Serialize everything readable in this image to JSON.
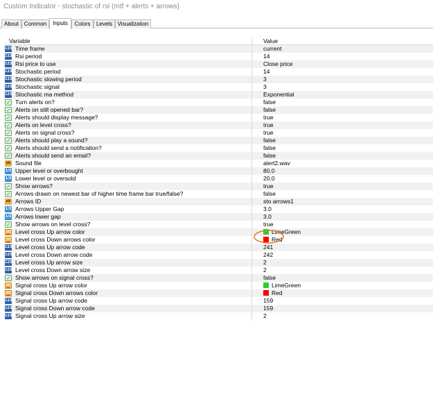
{
  "window_title": "Custom Indicator - stochastic of rsi (mtf + alerts + arrows)",
  "tabs": [
    {
      "label": "About",
      "active": false
    },
    {
      "label": "Common",
      "active": false
    },
    {
      "label": "Inputs",
      "active": true
    },
    {
      "label": "Colors",
      "active": false
    },
    {
      "label": "Levels",
      "active": false
    },
    {
      "label": "Visualization",
      "active": false
    }
  ],
  "columns": {
    "variable": "Variable",
    "value": "Value"
  },
  "icon_labels": {
    "int": "123",
    "double": "1/2",
    "bool": "✓",
    "string": "ab",
    "color": ""
  },
  "rows": [
    {
      "icon": "int",
      "variable": "Time frame",
      "value": "current"
    },
    {
      "icon": "int",
      "variable": "Rsi period",
      "value": "14"
    },
    {
      "icon": "int",
      "variable": "Rsi price to use",
      "value": "Close price"
    },
    {
      "icon": "int",
      "variable": "Stochastic period",
      "value": "14"
    },
    {
      "icon": "int",
      "variable": "Stochastic slowing period",
      "value": "3"
    },
    {
      "icon": "int",
      "variable": "Stochastic signal",
      "value": "3"
    },
    {
      "icon": "int",
      "variable": "Stochastic ma method",
      "value": "Exponential"
    },
    {
      "icon": "bool",
      "variable": "Turn alerts on?",
      "value": "false"
    },
    {
      "icon": "bool",
      "variable": "Alerts on still opened bar?",
      "value": "false"
    },
    {
      "icon": "bool",
      "variable": "Alerts should display message?",
      "value": "true"
    },
    {
      "icon": "bool",
      "variable": "Alerts on level cross?",
      "value": "true"
    },
    {
      "icon": "bool",
      "variable": "Alerts on signal cross?",
      "value": "true"
    },
    {
      "icon": "bool",
      "variable": "Alerts should play a sound?",
      "value": "false"
    },
    {
      "icon": "bool",
      "variable": "Alerts should send a notification?",
      "value": "false"
    },
    {
      "icon": "bool",
      "variable": "Alerts should send an email?",
      "value": "false"
    },
    {
      "icon": "string",
      "variable": "Sound file",
      "value": "alert2.wav"
    },
    {
      "icon": "double",
      "variable": "Upper level or overbought",
      "value": "80.0"
    },
    {
      "icon": "double",
      "variable": "Lower level or oversold",
      "value": "20.0"
    },
    {
      "icon": "bool",
      "variable": "Show arrows?",
      "value": "true"
    },
    {
      "icon": "bool",
      "variable": "Arrows drawn on newest bar of higher time frame bar true/false?",
      "value": "false"
    },
    {
      "icon": "string",
      "variable": "Arrows ID",
      "value": "sto arrows1"
    },
    {
      "icon": "double",
      "variable": "Arrows Upper Gap",
      "value": "3.0"
    },
    {
      "icon": "double",
      "variable": "Arrows lower gap",
      "value": "3.0"
    },
    {
      "icon": "bool",
      "variable": "Show arrows on level cross?",
      "value": "true"
    },
    {
      "icon": "color",
      "variable": "Level cross Up arrow color",
      "value": "LimeGreen",
      "swatch": "#32cd32"
    },
    {
      "icon": "color",
      "variable": "Level cross Down arrows color",
      "value": "Red",
      "swatch": "#ff0000"
    },
    {
      "icon": "int",
      "variable": "Level cross Up arrow code",
      "value": "241"
    },
    {
      "icon": "int",
      "variable": "Level cross Down arrow code",
      "value": "242"
    },
    {
      "icon": "int",
      "variable": "Level cross Up arrow size",
      "value": "2"
    },
    {
      "icon": "int",
      "variable": "Level cross Down arrow size",
      "value": "2"
    },
    {
      "icon": "bool",
      "variable": "Show arrows on signal cross?",
      "value": "false"
    },
    {
      "icon": "color",
      "variable": "Signal cross Up arrow color",
      "value": "LimeGreen",
      "swatch": "#32cd32"
    },
    {
      "icon": "color",
      "variable": "Signal cross Down arrows color",
      "value": "Red",
      "swatch": "#ff0000"
    },
    {
      "icon": "int",
      "variable": "Signal cross Up arrow code",
      "value": "159"
    },
    {
      "icon": "int",
      "variable": "Signal cross Down arrow code",
      "value": "159"
    },
    {
      "icon": "int",
      "variable": "Signal cross Up arrow size",
      "value": "2"
    }
  ],
  "colors": {
    "annotation": "#e87722",
    "grid_alt": "#f1f1f1"
  }
}
